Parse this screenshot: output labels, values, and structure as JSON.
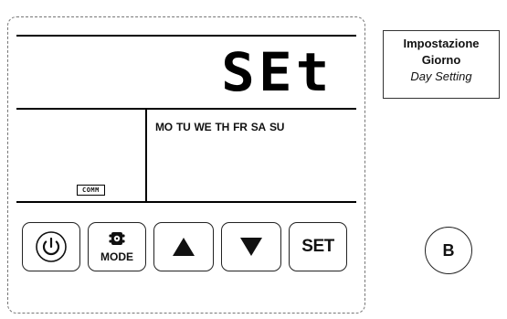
{
  "display": {
    "main_text": "SEt",
    "comm_label": "COMM",
    "days": [
      "MO",
      "TU",
      "WE",
      "TH",
      "FR",
      "SA",
      "SU"
    ]
  },
  "buttons": {
    "power_icon": "power-icon",
    "mode_label": "MODE",
    "up_icon": "arrow-up-icon",
    "down_icon": "arrow-down-icon",
    "set_label": "SET"
  },
  "info": {
    "title_line1": "Impostazione",
    "title_line2": "Giorno",
    "subtitle": "Day Setting"
  },
  "marker": {
    "label": "B"
  }
}
